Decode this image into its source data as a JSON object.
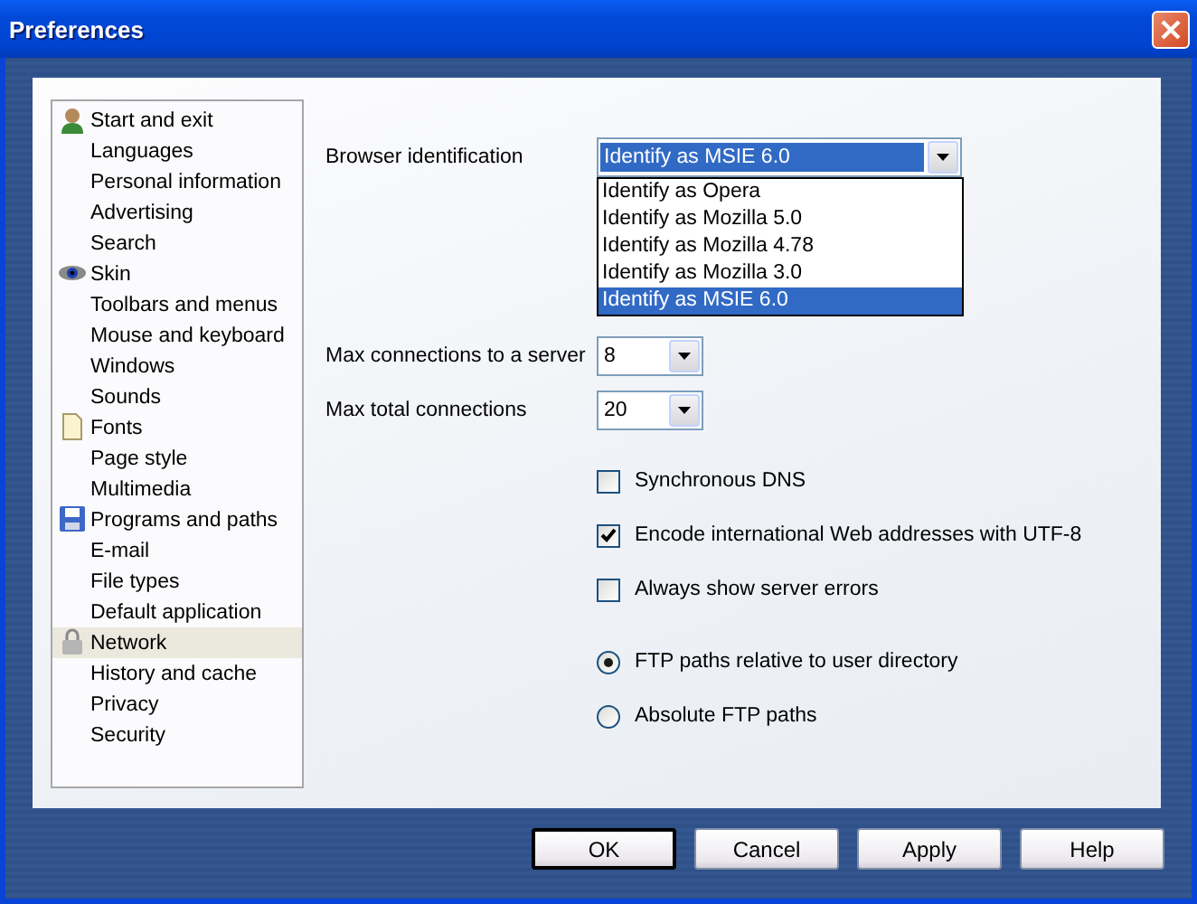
{
  "window": {
    "title": "Preferences"
  },
  "sidebar": {
    "items": [
      {
        "label": "Start and exit",
        "kind": "person",
        "selected": false
      },
      {
        "label": "Languages",
        "selected": false
      },
      {
        "label": "Personal information",
        "selected": false
      },
      {
        "label": "Advertising",
        "selected": false
      },
      {
        "label": "Search",
        "selected": false
      },
      {
        "label": "Skin",
        "kind": "eye",
        "selected": false
      },
      {
        "label": "Toolbars and menus",
        "selected": false
      },
      {
        "label": "Mouse and keyboard",
        "selected": false
      },
      {
        "label": "Windows",
        "selected": false
      },
      {
        "label": "Sounds",
        "selected": false
      },
      {
        "label": "Fonts",
        "kind": "page",
        "selected": false
      },
      {
        "label": "Page style",
        "selected": false
      },
      {
        "label": "Multimedia",
        "selected": false
      },
      {
        "label": "Programs and paths",
        "kind": "disk",
        "selected": false
      },
      {
        "label": "E-mail",
        "selected": false
      },
      {
        "label": "File types",
        "selected": false
      },
      {
        "label": "Default application",
        "selected": false
      },
      {
        "label": "Network",
        "kind": "lock",
        "selected": true
      },
      {
        "label": "History and cache",
        "selected": false
      },
      {
        "label": "Privacy",
        "selected": false
      },
      {
        "label": "Security",
        "selected": false
      }
    ]
  },
  "browser_identification": {
    "label": "Browser identification",
    "value": "Identify as MSIE 6.0",
    "open": true,
    "options": [
      {
        "label": "Identify as Opera",
        "selected": false
      },
      {
        "label": "Identify as Mozilla 5.0",
        "selected": false
      },
      {
        "label": "Identify as Mozilla 4.78",
        "selected": false
      },
      {
        "label": "Identify as Mozilla 3.0",
        "selected": false
      },
      {
        "label": "Identify as MSIE 6.0",
        "selected": true
      }
    ]
  },
  "connection_limits": [
    {
      "label": "Max connections to a server",
      "value": "8"
    },
    {
      "label": "Max total connections",
      "value": "20"
    }
  ],
  "checkboxes": [
    {
      "label": "Synchronous DNS",
      "checked": false
    },
    {
      "label": "Encode international Web addresses with UTF-8",
      "checked": true
    },
    {
      "label": "Always show server errors",
      "checked": false
    }
  ],
  "radios": [
    {
      "label": "FTP paths relative to user directory",
      "selected": true
    },
    {
      "label": "Absolute FTP paths",
      "selected": false
    }
  ],
  "buttons": [
    {
      "label": "OK",
      "default": true
    },
    {
      "label": "Cancel",
      "default": false
    },
    {
      "label": "Apply",
      "default": false
    },
    {
      "label": "Help",
      "default": false
    }
  ]
}
